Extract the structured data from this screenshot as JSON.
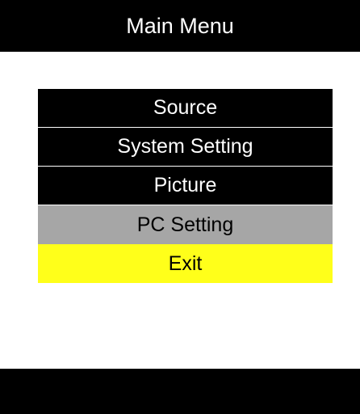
{
  "title": "Main Menu",
  "menu": {
    "items": [
      {
        "label": "Source",
        "state": "normal"
      },
      {
        "label": "System Setting",
        "state": "normal"
      },
      {
        "label": "Picture",
        "state": "normal"
      },
      {
        "label": "PC Setting",
        "state": "disabled"
      },
      {
        "label": "Exit",
        "state": "selected"
      }
    ]
  },
  "colors": {
    "background": "#ffffff",
    "bar": "#000000",
    "item_normal": "#000000",
    "item_disabled": "#a6a6a6",
    "item_selected": "#ffff1a"
  }
}
